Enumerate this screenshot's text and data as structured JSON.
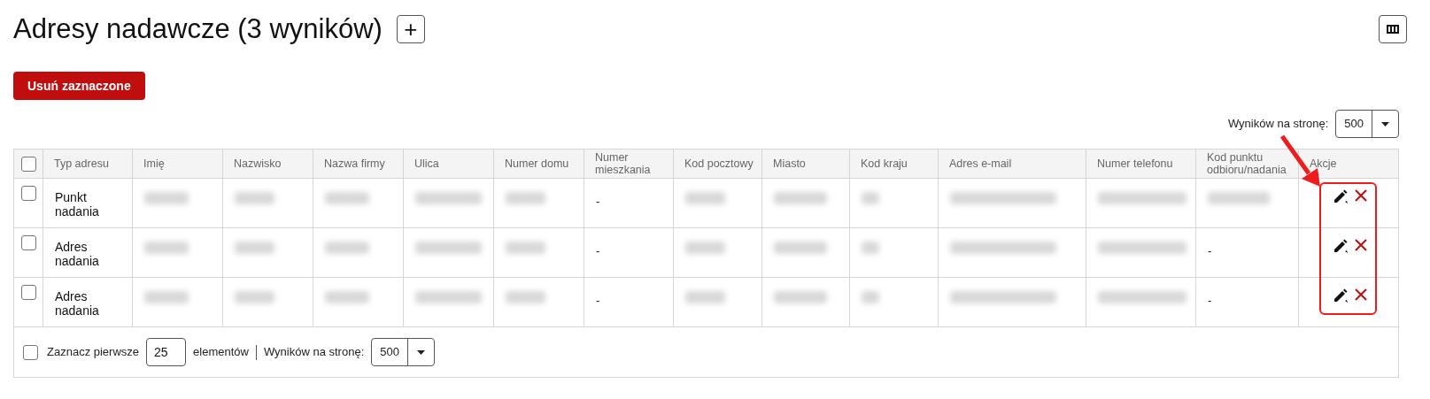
{
  "title": "Adresy nadawcze (3 wyników)",
  "add_button": "+",
  "delete_selected_button": "Usuń zaznaczone",
  "top_pager": {
    "label": "Wyników na stronę:",
    "value": "500"
  },
  "table": {
    "columns": [
      "Typ adresu",
      "Imię",
      "Nazwisko",
      "Nazwa firmy",
      "Ulica",
      "Numer domu",
      "Numer mieszkania",
      "Kod pocztowy",
      "Miasto",
      "Kod kraju",
      "Adres e-mail",
      "Numer telefonu",
      "Kod punktu odbioru/nadania",
      "Akcje"
    ],
    "header_checked": false,
    "rows": [
      {
        "checked": false,
        "cells": [
          {
            "kind": "text",
            "text": "Punkt nadania"
          },
          {
            "kind": "blurred"
          },
          {
            "kind": "blurred"
          },
          {
            "kind": "blurred"
          },
          {
            "kind": "blurred"
          },
          {
            "kind": "blurred"
          },
          {
            "kind": "text",
            "text": "-"
          },
          {
            "kind": "blurred"
          },
          {
            "kind": "blurred"
          },
          {
            "kind": "blurred"
          },
          {
            "kind": "blurred"
          },
          {
            "kind": "blurred"
          },
          {
            "kind": "blurred"
          }
        ]
      },
      {
        "checked": false,
        "cells": [
          {
            "kind": "text",
            "text": "Adres nadania"
          },
          {
            "kind": "blurred"
          },
          {
            "kind": "blurred"
          },
          {
            "kind": "blurred"
          },
          {
            "kind": "blurred"
          },
          {
            "kind": "blurred"
          },
          {
            "kind": "text",
            "text": "-"
          },
          {
            "kind": "blurred"
          },
          {
            "kind": "blurred"
          },
          {
            "kind": "blurred"
          },
          {
            "kind": "blurred"
          },
          {
            "kind": "blurred"
          },
          {
            "kind": "text",
            "text": "-"
          }
        ]
      },
      {
        "checked": false,
        "cells": [
          {
            "kind": "text",
            "text": "Adres nadania"
          },
          {
            "kind": "blurred"
          },
          {
            "kind": "blurred"
          },
          {
            "kind": "blurred"
          },
          {
            "kind": "blurred"
          },
          {
            "kind": "blurred"
          },
          {
            "kind": "text",
            "text": "-"
          },
          {
            "kind": "blurred"
          },
          {
            "kind": "blurred"
          },
          {
            "kind": "blurred"
          },
          {
            "kind": "blurred"
          },
          {
            "kind": "blurred"
          },
          {
            "kind": "text",
            "text": "-"
          }
        ]
      }
    ]
  },
  "footer": {
    "select_first_checked": false,
    "select_first_label": "Zaznacz pierwsze",
    "select_first_value": "25",
    "elements_label": "elementów",
    "pager_label": "Wyników na stronę:",
    "pager_value": "500"
  }
}
